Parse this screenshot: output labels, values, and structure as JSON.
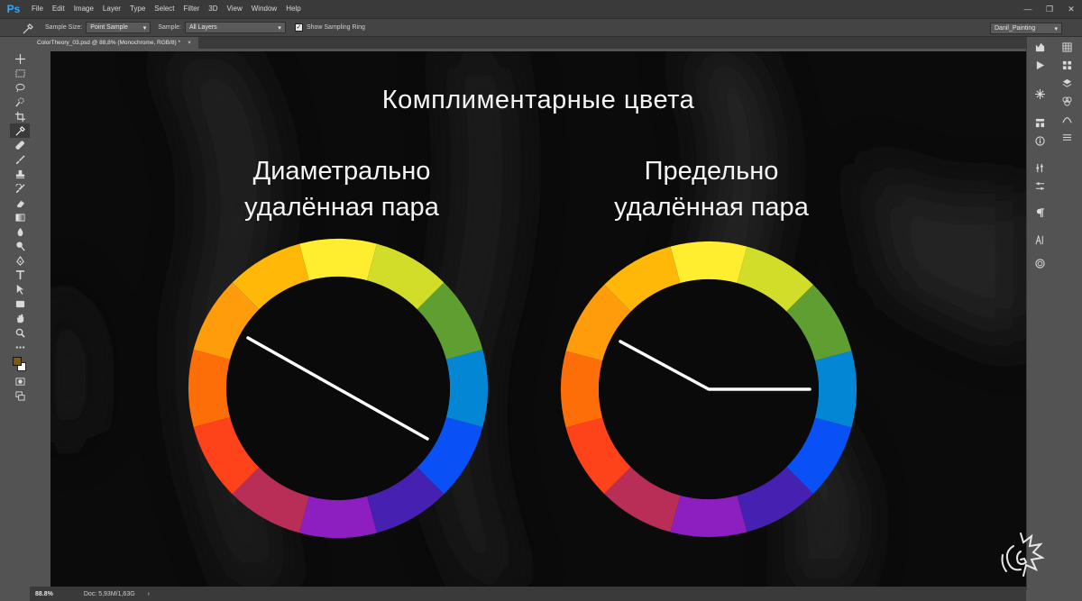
{
  "app": {
    "logo": "Ps"
  },
  "menu": [
    "File",
    "Edit",
    "Image",
    "Layer",
    "Type",
    "Select",
    "Filter",
    "3D",
    "View",
    "Window",
    "Help"
  ],
  "window_controls": {
    "minimize": "—",
    "restore": "❐",
    "close": "✕"
  },
  "options": {
    "sample_size_label": "Sample Size:",
    "sample_size_value": "Point Sample",
    "sample_label": "Sample:",
    "sample_value": "All Layers",
    "show_ring_checked": true,
    "show_ring_label": "Show Sampling Ring",
    "workspace": "Danil_Painting"
  },
  "document_tab": {
    "title": "ColorTheory_03.psd @ 88,8% (Monochrome, RGB/8) *",
    "close": "×"
  },
  "slide": {
    "title": "Комплиментарные цвета",
    "left_subtitle": [
      "Диаметрально",
      "удалённая пара"
    ],
    "right_subtitle": [
      "Предельно",
      "удалённая пара"
    ]
  },
  "status": {
    "zoom": "88.8%",
    "doc": "Doc: 5,93M/1,63G",
    "arrow": "›"
  },
  "colors": {
    "wheel_segments": [
      "#ffee30",
      "#d2dd2a",
      "#5f9f31",
      "#0387d4",
      "#0951f6",
      "#4620b0",
      "#8d1ec0",
      "#b92e56",
      "#fe421a",
      "#fe6e08",
      "#ff9c0b",
      "#ffb708"
    ],
    "foreground_swatch": "#7a5c12",
    "background_swatch": "#ffffff"
  }
}
